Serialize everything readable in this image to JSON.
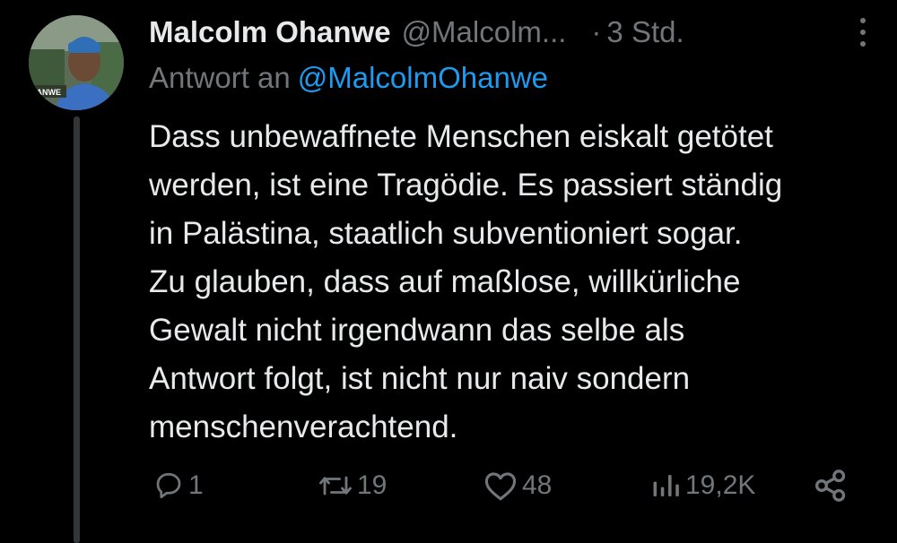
{
  "tweet": {
    "author": {
      "name": "Malcolm Ohanwe",
      "handle": "@Malcolm...",
      "avatar_caption": "HANWE"
    },
    "timestamp": "3 Std.",
    "separator": "·",
    "reply_to": {
      "prefix": "Antwort an",
      "mention": "@MalcolmOhanwe"
    },
    "text_lines": [
      "Dass unbewaffnete Menschen eiskalt getötet",
      "werden, ist eine Tragödie. Es passiert ständig",
      "in Palästina, staatlich subventioniert sogar.",
      "Zu glauben, dass auf maßlose, willkürliche",
      "Gewalt nicht irgendwann das selbe als",
      "Antwort folgt, ist nicht nur naiv sondern",
      "menschenverachtend."
    ],
    "stats": {
      "replies": "1",
      "reposts": "19",
      "likes": "48",
      "views": "19,2K"
    },
    "icons": {
      "reply": "reply-icon",
      "repost": "repost-icon",
      "like": "heart-icon",
      "views": "views-icon",
      "share": "share-icon",
      "more": "more-icon"
    }
  },
  "colors": {
    "background": "#000000",
    "text": "#e7e9ea",
    "muted": "#71767b",
    "link": "#1d9bf0",
    "thread_line": "#333639"
  }
}
